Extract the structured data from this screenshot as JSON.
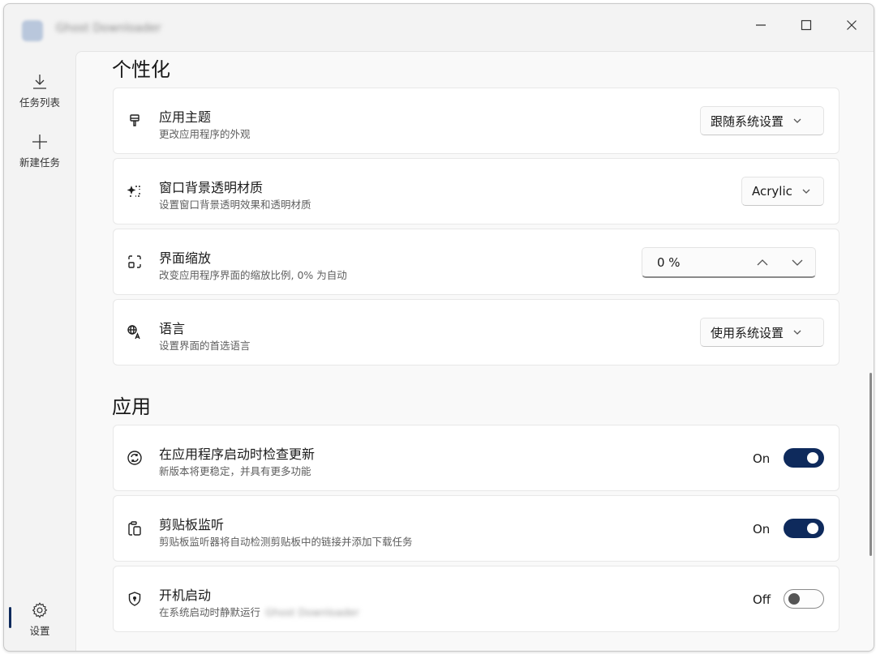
{
  "window": {
    "title": "Ghost Downloader"
  },
  "nav": {
    "tasks_label": "任务列表",
    "new_task_label": "新建任务",
    "settings_label": "设置"
  },
  "sections": {
    "personalization_title": "个性化",
    "app_title": "应用"
  },
  "personalization": {
    "theme": {
      "icon": "paintbrush-icon",
      "title": "应用主题",
      "desc": "更改应用程序的外观",
      "selected": "跟随系统设置"
    },
    "backdrop": {
      "icon": "backdrop-sparkle-icon",
      "title": "窗口背景透明材质",
      "desc": "设置窗口背景透明效果和透明材质",
      "selected": "Acrylic"
    },
    "zoom": {
      "icon": "zoom-frame-icon",
      "title": "界面缩放",
      "desc": "改变应用程序界面的缩放比例, 0% 为自动",
      "value": "0 %"
    },
    "language": {
      "icon": "translate-icon",
      "title": "语言",
      "desc": "设置界面的首选语言",
      "selected": "使用系统设置"
    }
  },
  "app": {
    "update_check": {
      "icon": "sync-icon",
      "title": "在应用程序启动时检查更新",
      "desc": "新版本将更稳定，并具有更多功能",
      "state_label": "On",
      "on": true
    },
    "clipboard": {
      "icon": "clipboard-icon",
      "title": "剪贴板监听",
      "desc": "剪贴板监听器将自动检测剪贴板中的链接并添加下载任务",
      "state_label": "On",
      "on": true
    },
    "autostart": {
      "icon": "shield-icon",
      "title": "开机启动",
      "desc": "在系统启动时静默运行",
      "desc_redacted": "Ghost Downloader",
      "state_label": "Off",
      "on": false
    }
  },
  "colors": {
    "accent": "#0e2a5c",
    "background": "#f3f3f3",
    "card": "#ffffff"
  }
}
